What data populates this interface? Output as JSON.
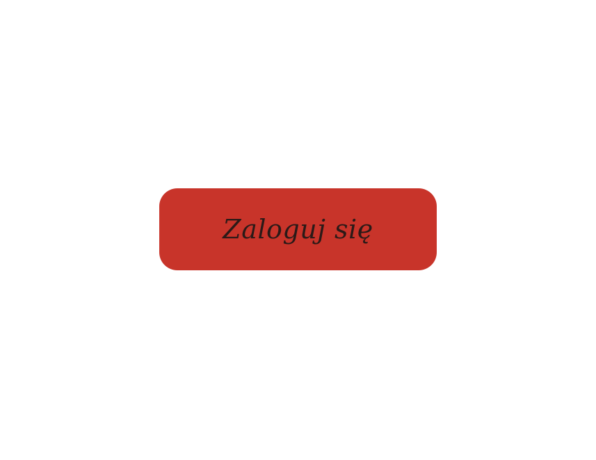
{
  "login_button": {
    "label": "Zaloguj się"
  },
  "colors": {
    "background": "#ffffff",
    "button_fill": "#c8342a",
    "button_text": "#2b1a18"
  }
}
